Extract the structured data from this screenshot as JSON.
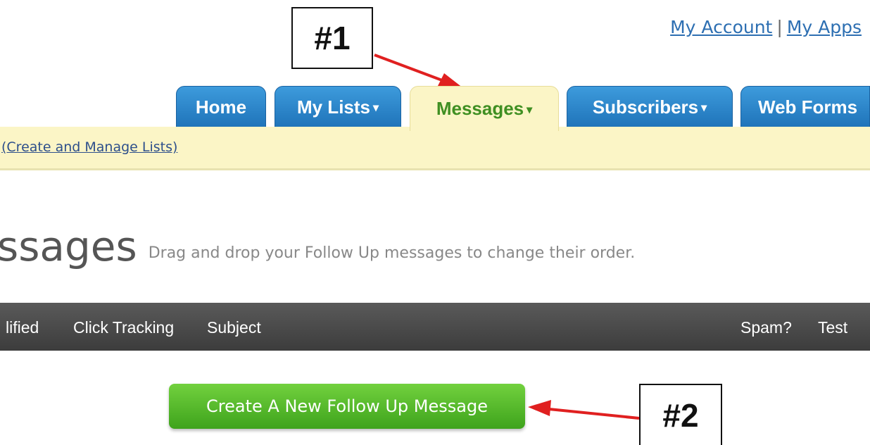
{
  "header": {
    "account_link": "My Account",
    "separator": "|",
    "apps_link": "My Apps"
  },
  "tabs": [
    {
      "label": "Home",
      "caret": ""
    },
    {
      "label": "My Lists",
      "caret": "▾"
    },
    {
      "label": "Messages",
      "caret": "▾",
      "active": true
    },
    {
      "label": "Subscribers",
      "caret": "▾"
    },
    {
      "label": "Web Forms",
      "caret": ""
    }
  ],
  "submenu": {
    "link": "(Create and Manage Lists)"
  },
  "page": {
    "title": "ssages",
    "subtitle": "Drag and drop your Follow Up messages to change their order."
  },
  "table_header": {
    "columns": [
      "lified",
      "Click Tracking",
      "Subject",
      "Spam?",
      "Test"
    ]
  },
  "actions": {
    "create_button": "Create A New Follow Up Message"
  },
  "annotations": {
    "callout_1": "#1",
    "callout_2": "#2",
    "arrow_color": "#e02020"
  },
  "colors": {
    "tab_blue": "#1f73b9",
    "tab_active_bg": "#fbf5c6",
    "tab_active_text": "#3f8f22",
    "button_green": "#4fb82a",
    "table_bar": "#4a4a4a"
  }
}
